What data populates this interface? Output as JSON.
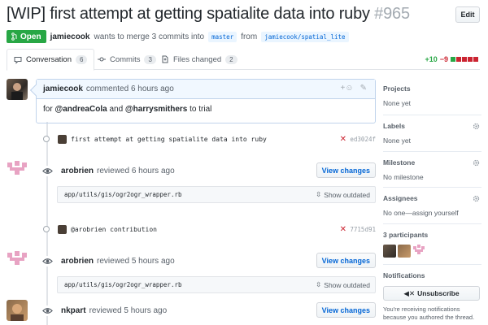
{
  "header": {
    "title": "[WIP] first attempt at getting spatialite data into ruby",
    "number": "#965",
    "edit_label": "Edit",
    "state_label": "Open",
    "author": "jamiecook",
    "meta_text": "wants to merge 3 commits into",
    "base_branch": "master",
    "from_text": "from",
    "head_branch": "jamiecook/spatial_lite"
  },
  "tabs": [
    {
      "label": "Conversation",
      "count": "6",
      "icon": "comment-icon"
    },
    {
      "label": "Commits",
      "count": "3",
      "icon": "commit-icon"
    },
    {
      "label": "Files changed",
      "count": "2",
      "icon": "file-diff-icon"
    }
  ],
  "diffstat": {
    "additions": "+10",
    "deletions": "−9",
    "colors": [
      "#28a745",
      "#cb2431",
      "#cb2431",
      "#cb2431",
      "#cb2431"
    ]
  },
  "comment": {
    "author": "jamiecook",
    "meta": "commented 6 hours ago",
    "body_prefix": "for",
    "mention1": "@andreaCola",
    "body_and": "and",
    "mention2": "@harrysmithers",
    "body_suffix": "to trial"
  },
  "timeline": {
    "commit1": {
      "message": "first attempt at getting spatialite data into ruby",
      "status": "✕",
      "sha": "ed3024f"
    },
    "review1": {
      "author": "arobrien",
      "meta": "reviewed 6 hours ago",
      "button": "View changes"
    },
    "file1": {
      "path": "app/utils/gis/ogr2ogr_wrapper.rb",
      "outdated": "Show outdated"
    },
    "commit2": {
      "message": "@arobrien contribution",
      "status": "✕",
      "sha": "7715d91"
    },
    "review2": {
      "author": "arobrien",
      "meta": "reviewed 5 hours ago",
      "button": "View changes"
    },
    "file2": {
      "path": "app/utils/gis/ogr2ogr_wrapper.rb",
      "outdated": "Show outdated"
    },
    "review3": {
      "author": "nkpart",
      "meta": "reviewed 5 hours ago",
      "button": "View changes"
    }
  },
  "sidebar": {
    "projects": {
      "title": "Projects",
      "value": "None yet"
    },
    "labels": {
      "title": "Labels",
      "value": "None yet"
    },
    "milestone": {
      "title": "Milestone",
      "value": "No milestone"
    },
    "assignees": {
      "title": "Assignees",
      "value": "No one—assign yourself"
    },
    "participants": {
      "title": "3 participants"
    },
    "notifications": {
      "title": "Notifications",
      "button": "Unsubscribe",
      "text": "You're receiving notifications because you authored the thread."
    }
  }
}
